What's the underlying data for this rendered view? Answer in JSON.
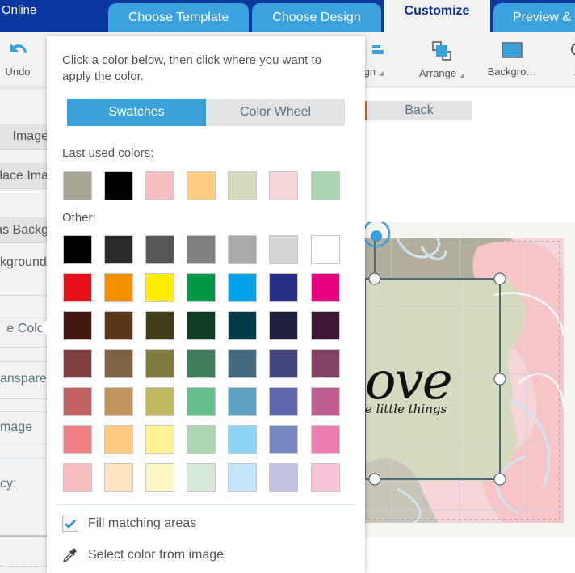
{
  "header": {
    "brand": "Online",
    "tabs": [
      {
        "label": "Choose Template",
        "active": false
      },
      {
        "label": "Choose Design",
        "active": false
      },
      {
        "label": "Customize",
        "active": true
      },
      {
        "label": "Preview &",
        "active": false
      }
    ]
  },
  "toolbar": {
    "undo": "Undo",
    "align": "lign",
    "arrange": "Arrange",
    "background": "Backgro…",
    "zoom": "Z"
  },
  "sidebar": {
    "items": [
      {
        "label": "Image"
      },
      {
        "label": "lace Ima"
      },
      {
        "label": "as Backg"
      },
      {
        "label": "kground A"
      },
      {
        "label": "e Color"
      },
      {
        "label": "ansparen"
      },
      {
        "label": "mage"
      },
      {
        "label": "cy:"
      }
    ]
  },
  "canvas": {
    "back_label": "Back",
    "design_text": "ove",
    "design_subtext": "e little things"
  },
  "color_popup": {
    "instructions": "Click a color below, then click where you want to apply the color.",
    "tabs": {
      "swatches": "Swatches",
      "color_wheel": "Color Wheel",
      "active": "Swatches"
    },
    "last_used_label": "Last used colors:",
    "last_used": [
      "#a7a593",
      "#000000",
      "#f7bec2",
      "#fecd82",
      "#d6dbbf",
      "#f6d5d9",
      "#aed5b3"
    ],
    "other_label": "Other:",
    "other": [
      [
        "#000000",
        "#2b2b2b",
        "#575757",
        "#808080",
        "#aaaaaa",
        "#d4d4d4",
        "#ffffff"
      ],
      [
        "#e60f1a",
        "#f49100",
        "#ffed00",
        "#009846",
        "#00a1e6",
        "#262e86",
        "#e6007e"
      ],
      [
        "#431710",
        "#5a3519",
        "#413d19",
        "#0f3d26",
        "#033a47",
        "#1d1f3c",
        "#3e1737"
      ],
      [
        "#813f42",
        "#7e6442",
        "#807c3f",
        "#3f7e5c",
        "#426b80",
        "#434580",
        "#824263"
      ],
      [
        "#c16163",
        "#c1955f",
        "#c0b95f",
        "#64bd8a",
        "#5fa1bf",
        "#5f67ac",
        "#bd5e8f"
      ],
      [
        "#f28186",
        "#fec980",
        "#fff394",
        "#b0d7b3",
        "#8dd3f4",
        "#7787c1",
        "#ec7fb0"
      ],
      [
        "#f7bdc0",
        "#ffe6c0",
        "#fdf7c2",
        "#d6e8d9",
        "#c2e5f9",
        "#c2c2e3",
        "#f7c1da"
      ]
    ],
    "fill_matching_label": "Fill matching areas",
    "fill_matching_checked": true,
    "select_from_image_label": "Select color from image"
  },
  "colors": {
    "header_bg": "#0a37a0",
    "tab_bg": "#3aa3dd",
    "accent": "#39a2db"
  }
}
